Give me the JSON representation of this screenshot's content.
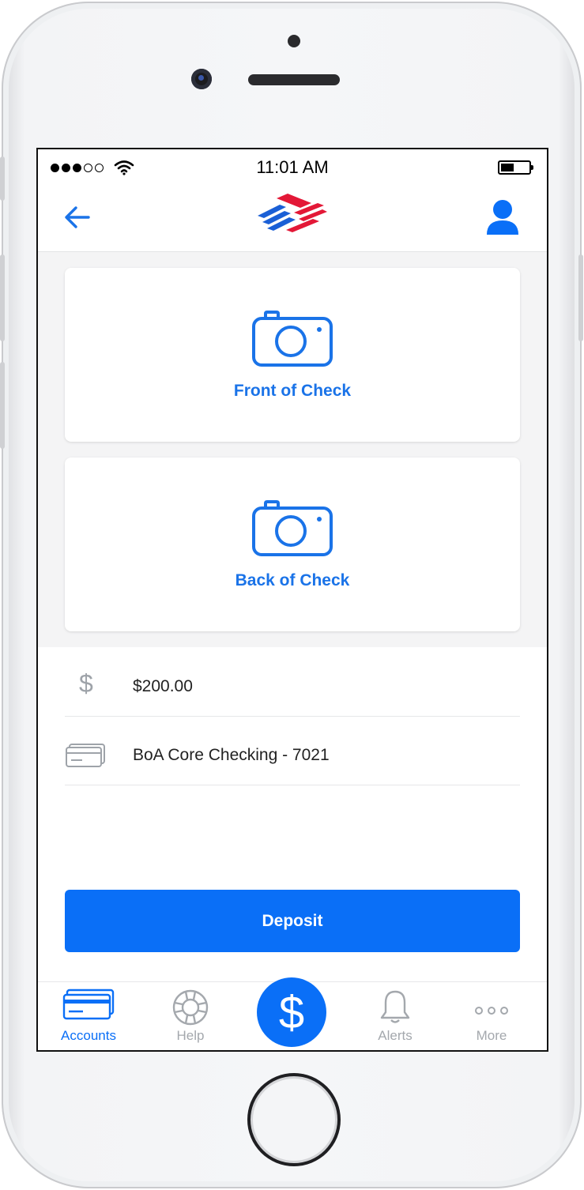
{
  "status_bar": {
    "time": "11:01 AM",
    "signal_icon": "signal-dots-icon",
    "wifi_icon": "wifi-icon",
    "battery_icon": "battery-icon"
  },
  "nav_bar": {
    "back_icon": "arrow-left-icon",
    "logo_icon": "bank-flag-logo",
    "profile_icon": "user-icon"
  },
  "checks": {
    "front_label": "Front of Check",
    "back_label": "Back of Check",
    "icon": "camera-icon"
  },
  "form": {
    "amount_icon": "$",
    "amount_value": "$200.00",
    "account_icon": "card-icon",
    "account_value": "BoA Core Checking - 7021"
  },
  "deposit_button": "Deposit",
  "tab_bar": {
    "tabs": [
      {
        "label": "Accounts",
        "icon": "credit-cards-icon",
        "active": true
      },
      {
        "label": "Help",
        "icon": "lifebuoy-icon",
        "active": false
      },
      {
        "label": "",
        "icon": "dollar-icon",
        "active": false
      },
      {
        "label": "Alerts",
        "icon": "bell-icon",
        "active": false
      },
      {
        "label": "More",
        "icon": "more-dots-icon",
        "active": false
      }
    ],
    "center_symbol": "$"
  },
  "colors": {
    "accent": "#0a6ff7",
    "inactive": "#a4a8ad",
    "logo_red": "#e31837",
    "logo_blue": "#1a5fd6"
  }
}
